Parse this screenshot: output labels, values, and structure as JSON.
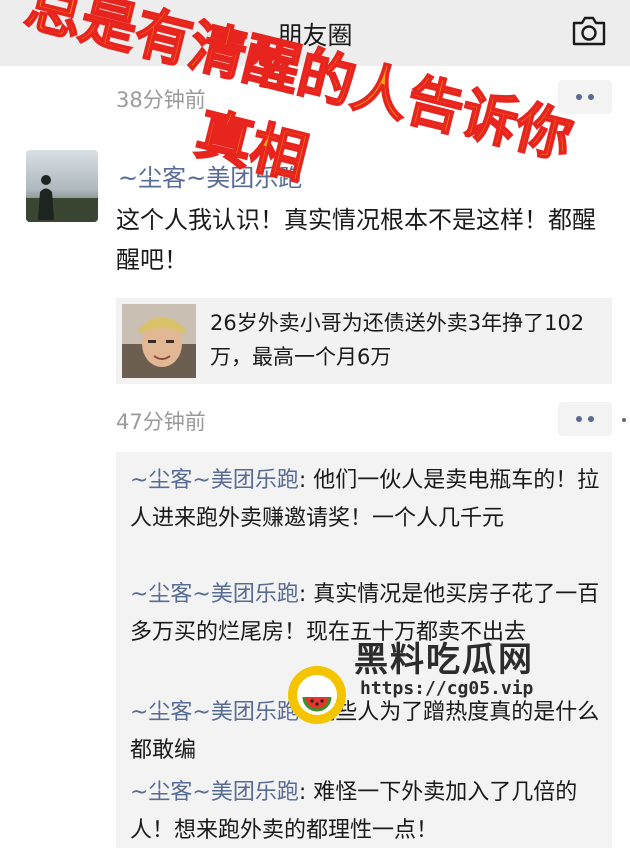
{
  "header": {
    "title": "朋友圈",
    "camera_icon": "camera-icon"
  },
  "post": {
    "time_above": "38分钟前",
    "author": "~尘客~美团乐跑",
    "text": "这个人我认识！真实情况根本不是这样！都醒醒吧！",
    "share": {
      "title": "26岁外卖小哥为还债送外卖3年挣了102万，最高一个月6万"
    },
    "time": "47分钟前"
  },
  "comments": [
    {
      "who": "~尘客~美团乐跑",
      "text": ": 他们一伙人是卖电瓶车的！拉人进来跑外卖赚邀请奖！一个人几千元"
    },
    {
      "who": "~尘客~美团乐跑",
      "text": ": 真实情况是他买房子花了一百多万买的烂尾房！现在五十万都卖不出去"
    },
    {
      "who": "~尘客~美团乐跑",
      "text": ": 这些人为了蹭热度真的是什么都敢编"
    },
    {
      "who": "~尘客~美团乐跑",
      "text": ": 难怪一下外卖加入了几倍的人！想来跑外卖的都理性一点！"
    }
  ],
  "overlay": {
    "line1": "总是有清醒的人告诉你",
    "line2": "真相",
    "color": "#f2a40c",
    "stroke": "#e8241f"
  },
  "watermark": {
    "brand": "黑料吃瓜网",
    "url": "https://cg05.vip"
  },
  "colors": {
    "link": "#576b95",
    "topbar": "#ededed",
    "comment_bg": "#f3f3f3"
  }
}
